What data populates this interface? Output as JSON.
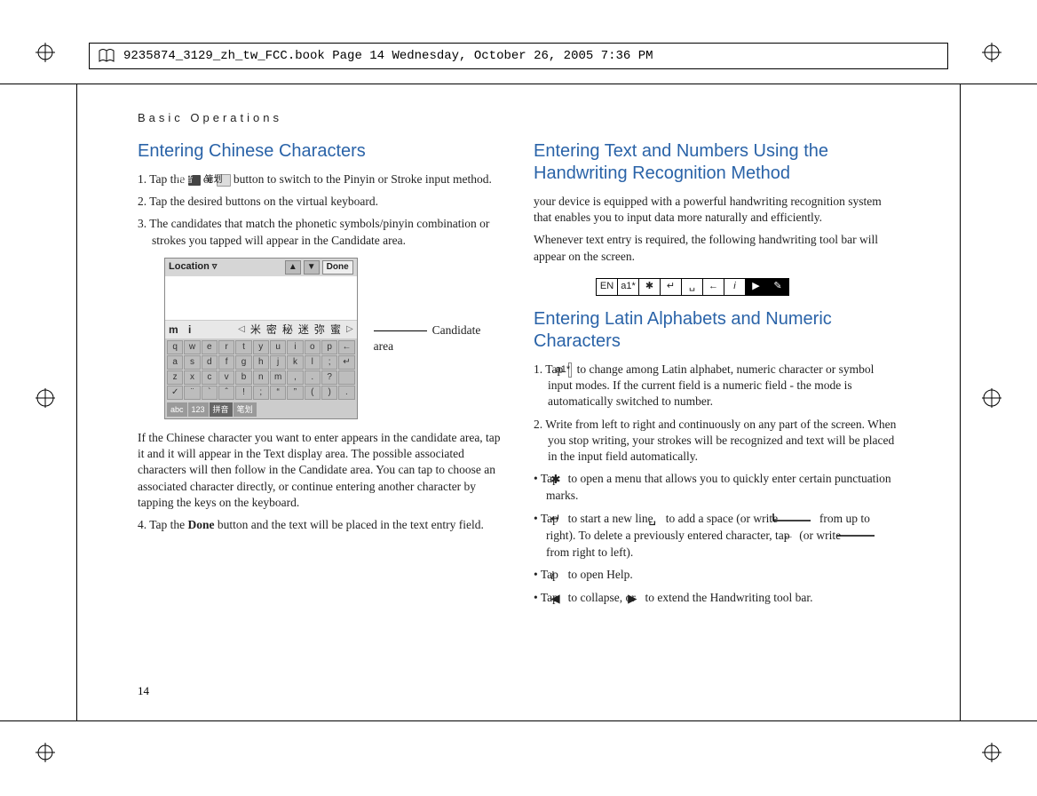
{
  "print": {
    "header_text": "9235874_3129_zh_tw_FCC.book  Page 14  Wednesday, October 26, 2005  7:36 PM"
  },
  "section_header": "Basic Operations",
  "page_number": "14",
  "left": {
    "h1": "Entering Chinese Characters",
    "step1_a": "1. Tap the ",
    "step1_b": " or ",
    "step1_c": " button to switch to the Pinyin or Stroke input method.",
    "pinyin_btn": "拼音",
    "stroke_btn": "笔划",
    "step2": "2. Tap the desired buttons on the virtual keyboard.",
    "step3": "3. The candidates that match the phonetic symbols/pinyin combination or strokes you tapped will appear in the Candidate area.",
    "fig": {
      "title": "Location",
      "done": "Done",
      "typed": "m i",
      "candidates": [
        "米",
        "密",
        "秘",
        "迷",
        "弥",
        "蜜"
      ],
      "rows": [
        [
          "q",
          "w",
          "e",
          "r",
          "t",
          "y",
          "u",
          "i",
          "o",
          "p",
          "←"
        ],
        [
          "a",
          "s",
          "d",
          "f",
          "g",
          "h",
          "j",
          "k",
          "l",
          ";",
          "↵"
        ],
        [
          "z",
          "x",
          "c",
          "v",
          "b",
          "n",
          "m",
          ",",
          ".",
          "?",
          " "
        ],
        [
          "✓",
          "¨",
          "`",
          "ˆ",
          "!",
          ";",
          "“",
          "”",
          "(",
          ")",
          "."
        ]
      ],
      "modes": [
        "abc",
        "123",
        "拼音",
        "笔划"
      ]
    },
    "candidate_label": "Candidate area",
    "para1": "If the Chinese character you want to enter appears in the candidate area, tap it and it will appear in the Text display area. The possible associated characters will then follow in the Candidate area. You can tap to choose an associated character directly, or continue entering another character by tapping the keys on the keyboard.",
    "step4_a": "4. Tap the ",
    "step4_b": "Done",
    "step4_c": " button and the text will be placed in the text entry field."
  },
  "right": {
    "h1": "Entering Text and Numbers Using the Handwriting Recognition Method",
    "para1": "your device is equipped with a powerful handwriting recognition system that enables you to input data more naturally and efficiently.",
    "para2": "Whenever text entry is required, the following handwriting tool bar will appear on the screen.",
    "toolbar": [
      "EN",
      "a1*",
      "✱",
      "↵",
      "␣",
      "←",
      "i",
      "▶",
      "✎"
    ],
    "h2": "Entering Latin Alphabets and Numeric Characters",
    "step1_a": "1. Tap ",
    "step1_mode": "a1*",
    "step1_b": " to change among Latin alphabet, numeric character or symbol input modes. If the current field is a numeric field - the mode is automatically switched to number.",
    "step2": "2. Write from left to right and continuously on any part of the screen. When you stop writing, your strokes will be recognized and text will be placed in the input field automatically.",
    "b1_a": "• Tap ",
    "b1_b": " to open a menu that allows you to quickly enter certain punctuation marks.",
    "b2_a": "• Tap ",
    "b2_b": " to start a new line, ",
    "b2_c": " to add a space (or write ",
    "b2_d": " from up to right). To delete a previously entered character, tap ",
    "b2_e": " (or write ",
    "b2_f": " from right to left).",
    "b3_a": "• Tap ",
    "b3_b": " to open Help.",
    "b4_a": "• Tap ",
    "b4_b": " to collapse, or ",
    "b4_c": " to extend the Handwriting tool bar."
  }
}
